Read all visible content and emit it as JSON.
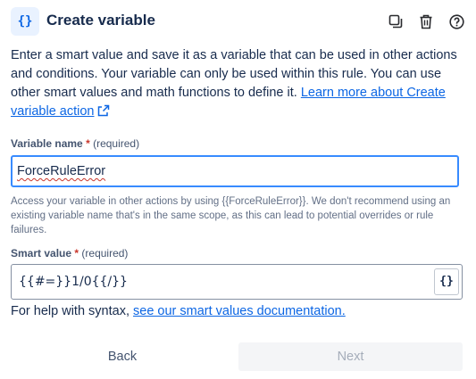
{
  "header": {
    "icon_glyph": "{}",
    "icon": "curly-braces-icon",
    "title": "Create variable",
    "actions": [
      {
        "name": "duplicate-icon"
      },
      {
        "name": "trash-icon"
      },
      {
        "name": "help-icon"
      }
    ]
  },
  "description": {
    "text": "Enter a smart value and save it as a variable that can be used in other actions and conditions. Your variable can only be used within this rule. You can use other smart values and math functions to define it.",
    "link_text": "Learn more about Create variable action",
    "link_icon": "external-link-icon"
  },
  "variable_name": {
    "label": "Variable name",
    "required_star": "*",
    "required_text": "(required)",
    "value": "ForceRuleError",
    "helper_text": "Access your variable in other actions by using {{ForceRuleError}}. We don't recommend using an existing variable name that's in the same scope, as this can lead to potential overrides or rule failures."
  },
  "smart_value": {
    "label": "Smart value",
    "required_star": "*",
    "required_text": "(required)",
    "value": "{{#=}}1/0{{/}}",
    "button_glyph": "{}"
  },
  "help": {
    "text": "For help with syntax,",
    "link_text": "see our smart values documentation."
  },
  "footer": {
    "back_label": "Back",
    "next_label": "Next"
  },
  "colors": {
    "accent": "#0c66e4",
    "focus_border": "#388bff",
    "required": "#c9372c",
    "disabled_text": "#a5adba"
  }
}
